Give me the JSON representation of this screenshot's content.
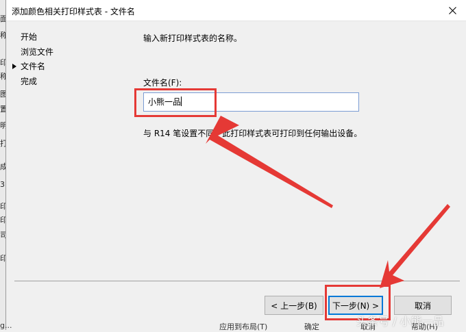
{
  "background": {
    "left_edge_glyphs": [
      "面",
      "称",
      "印",
      "称",
      "图",
      "置",
      "明",
      "打",
      "成",
      "3",
      "印",
      "印",
      "司",
      "印"
    ],
    "bottom_cut_labels": [
      "g...",
      "应用到布局(T)",
      "确定",
      "取消",
      "帮助(H)"
    ]
  },
  "dialog": {
    "title": "添加颜色相关打印样式表 - 文件名",
    "close_icon": "close-icon"
  },
  "nav": {
    "items": [
      {
        "label": "开始",
        "current": false
      },
      {
        "label": "浏览文件",
        "current": false
      },
      {
        "label": "文件名",
        "current": true
      },
      {
        "label": "完成",
        "current": false
      }
    ]
  },
  "main": {
    "instruction": "输入新打印样式表的名称。",
    "filename_label": "文件名(F):",
    "filename_value": "小熊一品",
    "note": "与 R14 笔设置不同，此打印样式表可打印到任何输出设备。"
  },
  "buttons": {
    "back": "< 上一步(B)",
    "next": "下一步(N) >",
    "cancel": "取消"
  },
  "annotations": {
    "color": "#e53935"
  },
  "watermark": "头条号 / 小熊一品"
}
